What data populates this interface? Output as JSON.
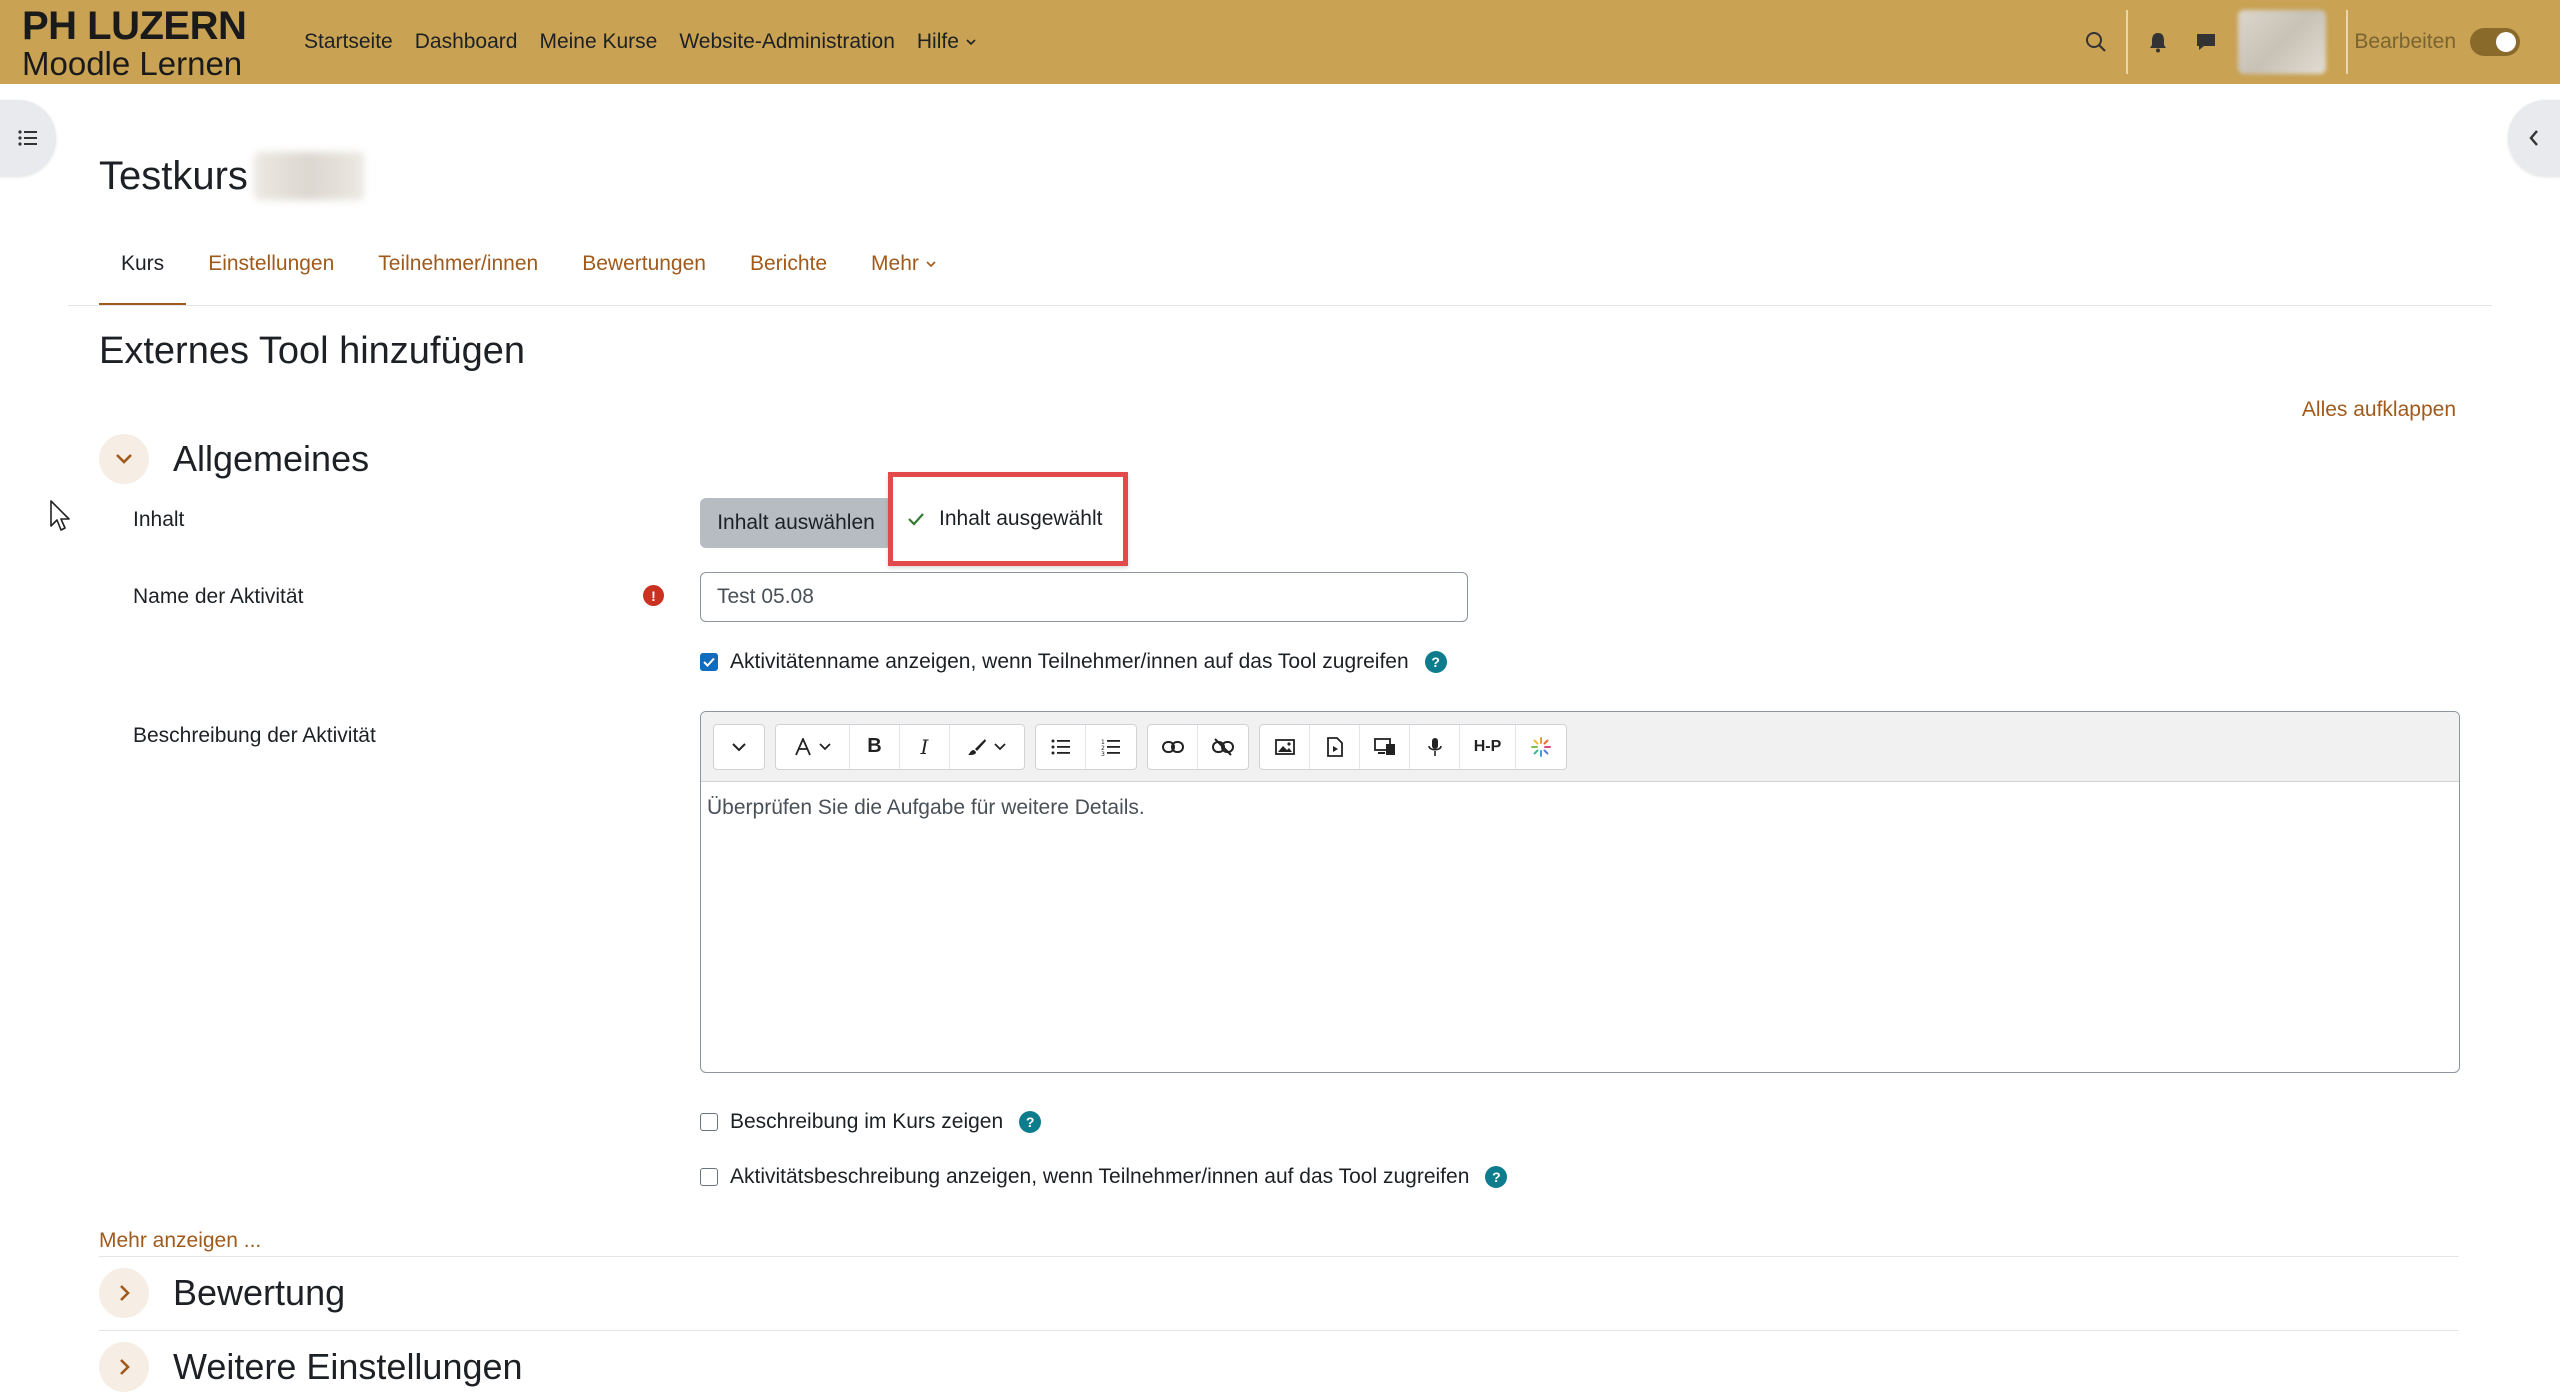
{
  "brand": {
    "line1": "PH LUZERN",
    "line2": "Moodle Lernen"
  },
  "primary_nav": [
    "Startseite",
    "Dashboard",
    "Meine Kurse",
    "Website-Administration"
  ],
  "help_menu": "Hilfe",
  "edit_mode_label": "Bearbeiten",
  "icons": {
    "search": "search-icon",
    "notifications": "bell-icon",
    "messages": "chat-icon",
    "drawer_left": "list-icon",
    "drawer_right": "chevron-left-icon"
  },
  "course": {
    "title": "Testkurs"
  },
  "secondary_nav": {
    "kurs": "Kurs",
    "einstellungen": "Einstellungen",
    "teilnehmer": "Teilnehmer/innen",
    "bewertungen": "Bewertungen",
    "berichte": "Berichte",
    "mehr": "Mehr"
  },
  "page_heading": "Externes Tool hinzufügen",
  "expand_all": "Alles aufklappen",
  "sections": {
    "general": "Allgemeines",
    "grading": "Bewertung",
    "further": "Weitere Einstellungen"
  },
  "form": {
    "content_label": "Inhalt",
    "select_content_button": "Inhalt auswählen",
    "content_selected": "Inhalt ausgewählt",
    "name_label": "Name der Aktivität",
    "name_value": "Test 05.08",
    "show_name_checkbox": "Aktivitätenname anzeigen, wenn Teilnehmer/innen auf das Tool zugreifen",
    "show_name_checked": true,
    "description_label": "Beschreibung der Aktivität",
    "description_text": "Überprüfen Sie die Aufgabe für weitere Details.",
    "show_desc_course": "Beschreibung im Kurs zeigen",
    "show_desc_tool": "Aktivitätsbeschreibung anzeigen, wenn Teilnehmer/innen auf das Tool zugreifen",
    "more_link": "Mehr anzeigen ..."
  },
  "colors": {
    "navbar": "#c9a253",
    "link": "#a05a1b",
    "highlight": "#e2494b",
    "primary": "#0f6cbf"
  }
}
